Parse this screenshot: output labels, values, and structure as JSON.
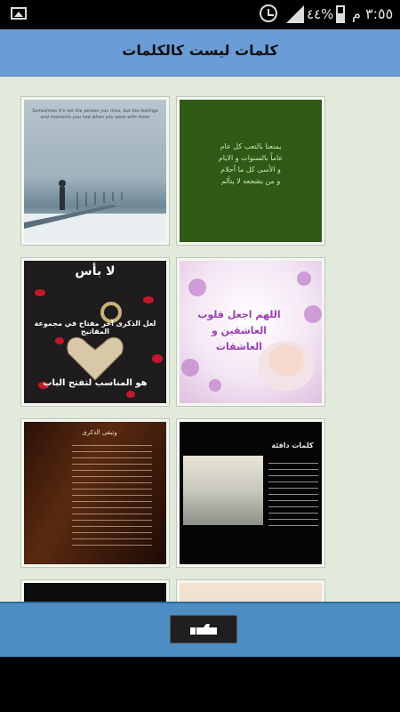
{
  "status_bar": {
    "battery_percent": "٤٤%",
    "clock": "٣:٥٥ م",
    "icons": [
      "gallery-icon",
      "alarm-icon",
      "signal-icon",
      "battery-icon"
    ]
  },
  "header": {
    "title": "كلمات ليست كالكلمات"
  },
  "tiles": [
    {
      "name": "tile-green-text",
      "lines": [
        "يمنعنا بالتعب كل عام",
        "عاماً بالسنوات و الايام",
        "و الأسى كل ما أحلام",
        "و من يشجعه لا يتألم"
      ]
    },
    {
      "name": "tile-snow-pier",
      "caption": "Sometimes it's not the person you miss, but the feelings and moments you had when you were with them"
    },
    {
      "name": "tile-flowers-dua",
      "lines": [
        "اللهم اجعل قلوب",
        "العاشقين و العاشقات"
      ]
    },
    {
      "name": "tile-heart-key",
      "lines": [
        "لا بأس",
        "لعل الذكرى آخر مفتاح في مجموعة المفاتيح",
        "هو المناسب لتفتح الباب"
      ]
    },
    {
      "name": "tile-black-sea",
      "lines": [
        "كلمات دافئة"
      ]
    },
    {
      "name": "tile-dark-brown-text",
      "lines": [
        "وتبقى الذكرى"
      ]
    },
    {
      "name": "tile-partial-left"
    },
    {
      "name": "tile-partial-right"
    }
  ],
  "colors": {
    "title_bar": "#6a9cd8",
    "content_bg": "#e1eadb",
    "bottom_bar": "#4c8dc4"
  },
  "ad_button": {
    "icon": "thumbs-up-icon"
  }
}
